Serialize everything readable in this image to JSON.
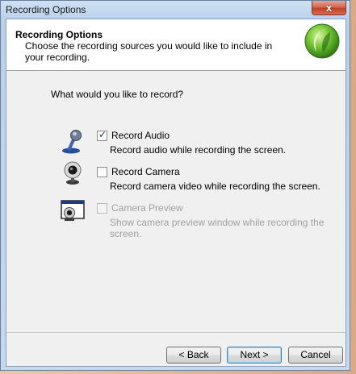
{
  "window": {
    "title": "Recording Options",
    "close_glyph": "x"
  },
  "header": {
    "title": "Recording Options",
    "subtitle": "Choose the recording sources you would like to include in your recording."
  },
  "question": "What would you like to record?",
  "options": [
    {
      "label": "Record Audio",
      "description": "Record audio while recording the screen.",
      "checked": true,
      "enabled": true,
      "icon": "microphone-icon"
    },
    {
      "label": "Record Camera",
      "description": "Record camera video while recording the screen.",
      "checked": false,
      "enabled": true,
      "icon": "webcam-icon"
    },
    {
      "label": "Camera Preview",
      "description": "Show camera preview window while recording the screen.",
      "checked": false,
      "enabled": false,
      "icon": "camera-preview-window-icon"
    }
  ],
  "buttons": {
    "back": "< Back",
    "next": "Next >",
    "cancel": "Cancel"
  },
  "colors": {
    "accent": "#3c7fb1",
    "logo_green": "#6fc03a",
    "close_red": "#c1412a"
  }
}
